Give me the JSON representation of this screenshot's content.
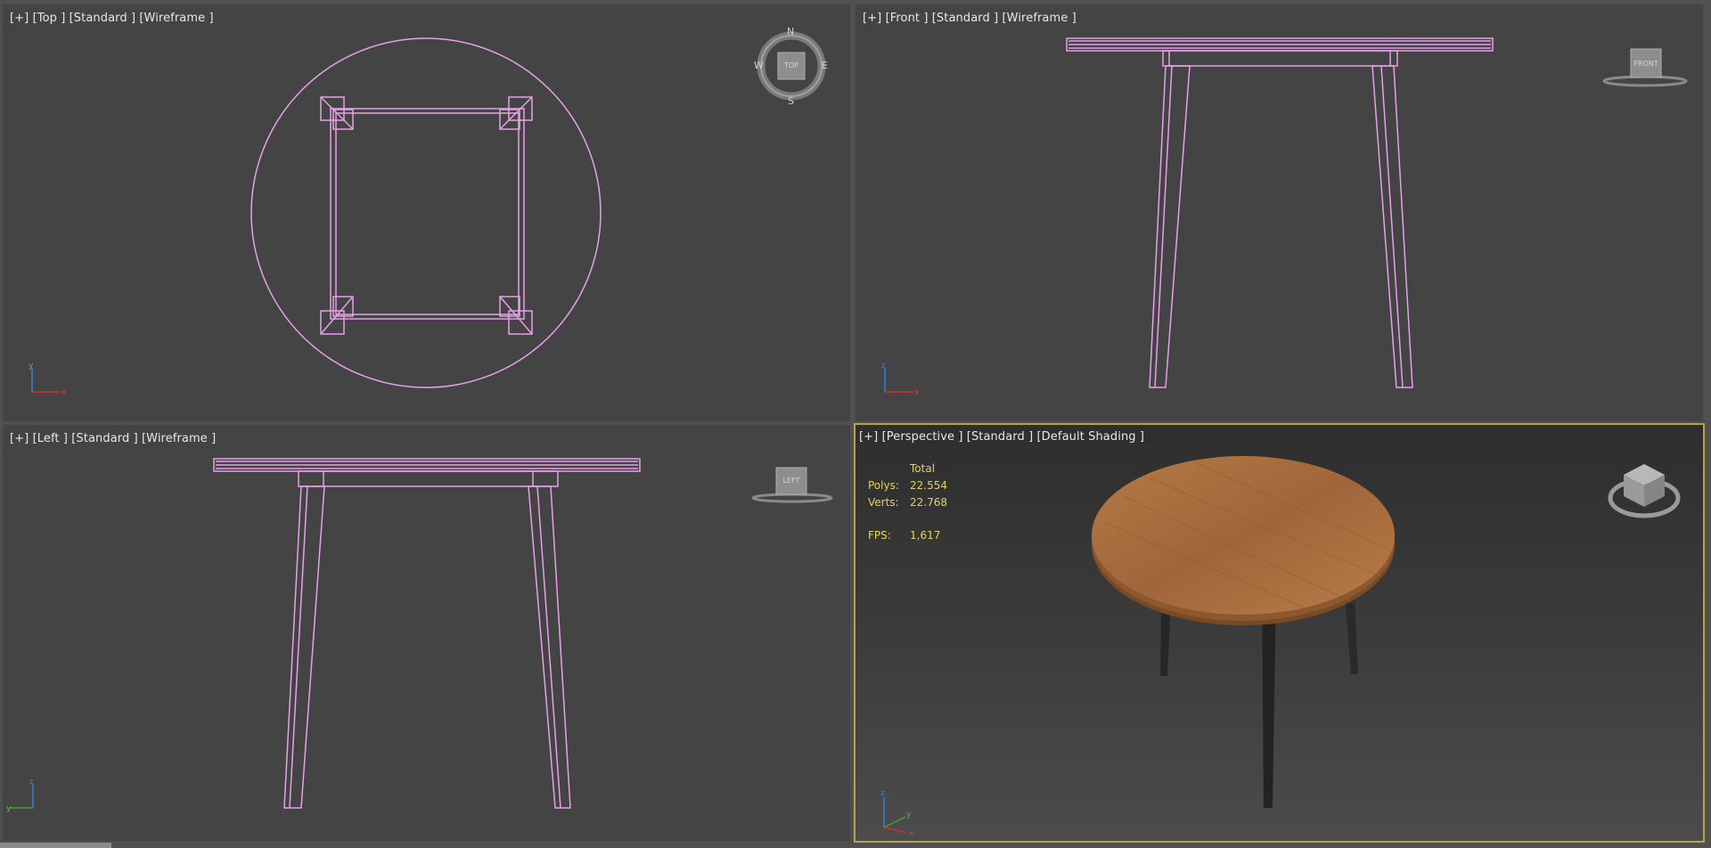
{
  "viewports": {
    "top": {
      "label": "[+] [Top ] [Standard ] [Wireframe ]",
      "gizmo": "TOP",
      "compass": {
        "n": "N",
        "s": "S",
        "e": "E",
        "w": "W"
      },
      "axes": [
        "y",
        "x"
      ]
    },
    "front": {
      "label": "[+] [Front ] [Standard ] [Wireframe ]",
      "gizmo": "FRONT",
      "axes": [
        "z",
        "x"
      ]
    },
    "left": {
      "label": "[+] [Left ] [Standard ] [Wireframe ]",
      "gizmo": "LEFT",
      "axes": [
        "z",
        "y"
      ]
    },
    "perspective": {
      "label": "[+] [Perspective ] [Standard ] [Default Shading ]",
      "stats": {
        "total_label": "Total",
        "polys_label": "Polys:",
        "polys_value": "22.554",
        "verts_label": "Verts:",
        "verts_value": "22.768",
        "fps_label": "FPS:",
        "fps_value": "1,617"
      },
      "axes": [
        "z",
        "y",
        "x"
      ]
    }
  },
  "colors": {
    "wire": "#e8a0ea",
    "active_border": "#b6a24b",
    "stats_text": "#e6d25a",
    "wood": "#a86b3a",
    "legs": "#2b2b2b"
  }
}
